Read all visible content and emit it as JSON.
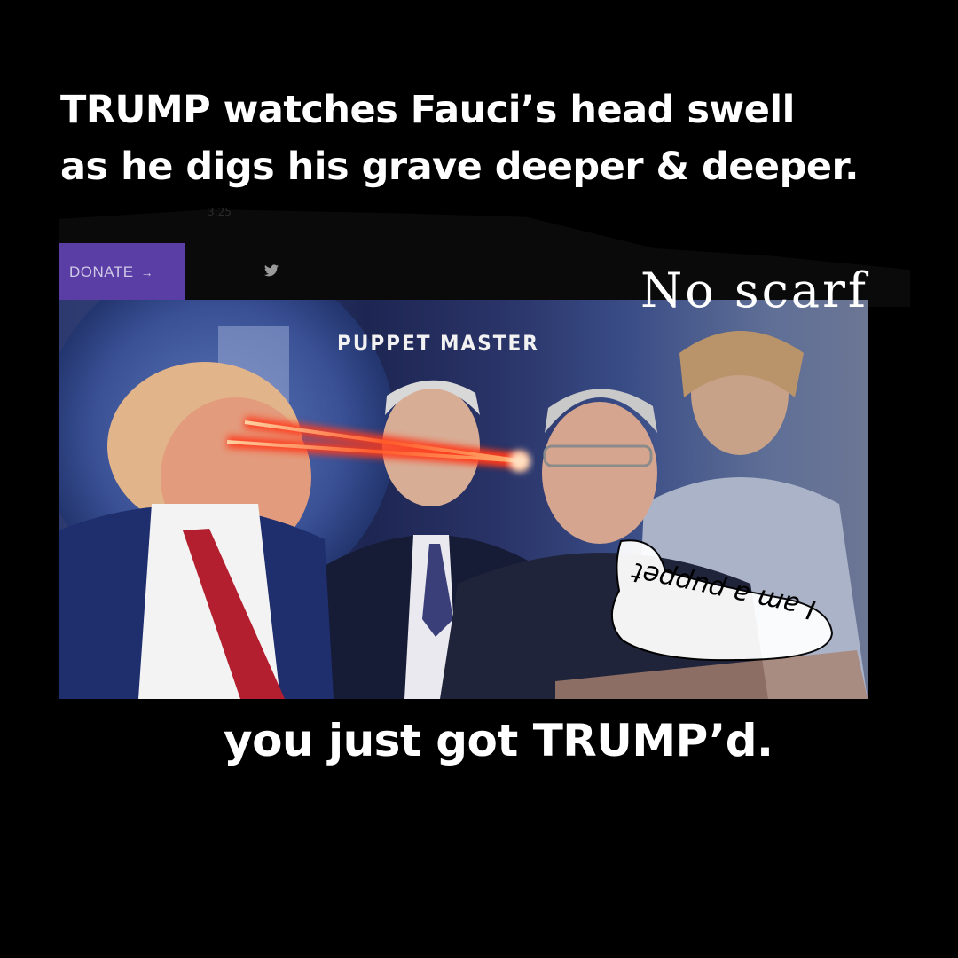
{
  "headline": {
    "line1": "TRUMP watches Fauci’s head swell",
    "line2": "as he digs his grave deeper & deeper."
  },
  "faint_time": "3:25",
  "donate_button": {
    "label": "DONATE",
    "arrow": "→"
  },
  "icons": {
    "social": "twitter-icon"
  },
  "photo_caption": "PUPPET MASTER",
  "overlay_text": "No scarf",
  "speech_bubble_text": "I am a puppet",
  "footer": "you just got TRUMP’d.",
  "colors": {
    "background": "#000000",
    "donate_bg": "#5a3ea6",
    "laser": "#ff3a1a"
  }
}
